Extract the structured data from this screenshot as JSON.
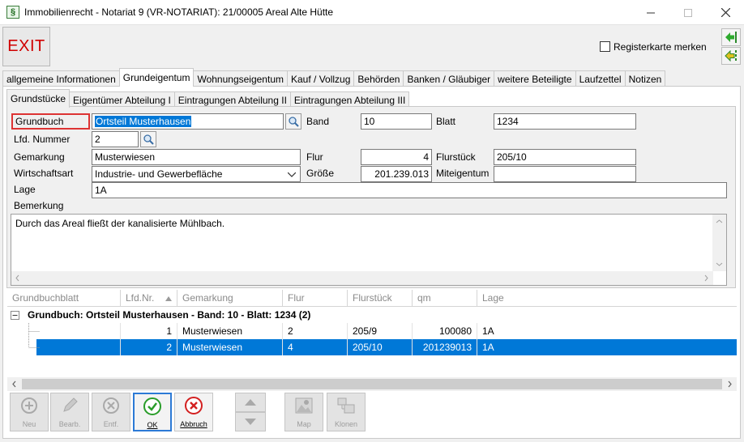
{
  "window": {
    "title": "Immobilienrecht - Notariat 9 (VR-NOTARIAT): 21/00005 Areal Alte Hütte",
    "icon": "document-section-icon"
  },
  "toolbar": {
    "exit_label": "EXIT",
    "register_label": "Registerkarte merken",
    "register_checked": false
  },
  "main_tabs": [
    "allgemeine Informationen",
    "Grundeigentum",
    "Wohnungseigentum",
    "Kauf / Vollzug",
    "Behörden",
    "Banken / Gläubiger",
    "weitere Beteiligte",
    "Laufzettel",
    "Notizen"
  ],
  "sub_tabs": [
    "Grundstücke",
    "Eigentümer Abteilung I",
    "Eintragungen Abteilung II",
    "Eintragungen Abteilung III"
  ],
  "form": {
    "grundbuch_label": "Grundbuch",
    "grundbuch_value": "Ortsteil Musterhausen",
    "band_label": "Band",
    "band_value": "10",
    "blatt_label": "Blatt",
    "blatt_value": "1234",
    "lfd_label": "Lfd. Nummer",
    "lfd_value": "2",
    "gemarkung_label": "Gemarkung",
    "gemarkung_value": "Musterwiesen",
    "flur_label": "Flur",
    "flur_value": "4",
    "flurstueck_label": "Flurstück",
    "flurstueck_value": "205/10",
    "wirtschaftsart_label": "Wirtschaftsart",
    "wirtschaftsart_value": "Industrie- und Gewerbefläche",
    "groesse_label": "Größe",
    "groesse_value": "201.239.013",
    "miteigentum_label": "Miteigentum",
    "miteigentum_value": "",
    "lage_label": "Lage",
    "lage_value": "1A",
    "bemerkung_label": "Bemerkung",
    "bemerkung_value": "Durch das Areal fließt der kanalisierte Mühlbach."
  },
  "grid": {
    "columns": [
      "Grundbuchblatt",
      "Lfd.Nr.",
      "Gemarkung",
      "Flur",
      "Flurstück",
      "qm",
      "Lage"
    ],
    "group_label": "Grundbuch: Ortsteil Musterhausen - Band: 10 - Blatt: 1234 (2)",
    "rows": [
      {
        "lfd": "1",
        "gemarkung": "Musterwiesen",
        "flur": "2",
        "flurstueck": "205/9",
        "qm": "100080",
        "lage": "1A",
        "selected": false
      },
      {
        "lfd": "2",
        "gemarkung": "Musterwiesen",
        "flur": "4",
        "flurstueck": "205/10",
        "qm": "201239013",
        "lage": "1A",
        "selected": true
      }
    ]
  },
  "bottom_toolbar": {
    "new_label": "Neu",
    "edit_label": "Bearb.",
    "delete_label": "Entf.",
    "ok_label": "OK",
    "cancel_label": "Abbruch",
    "map_label": "Map",
    "clone_label": "Klonen"
  },
  "colors": {
    "accent": "#0078d7",
    "exit_red": "#d00000",
    "ok_green": "#2a9d2a",
    "cancel_red": "#d32020"
  }
}
